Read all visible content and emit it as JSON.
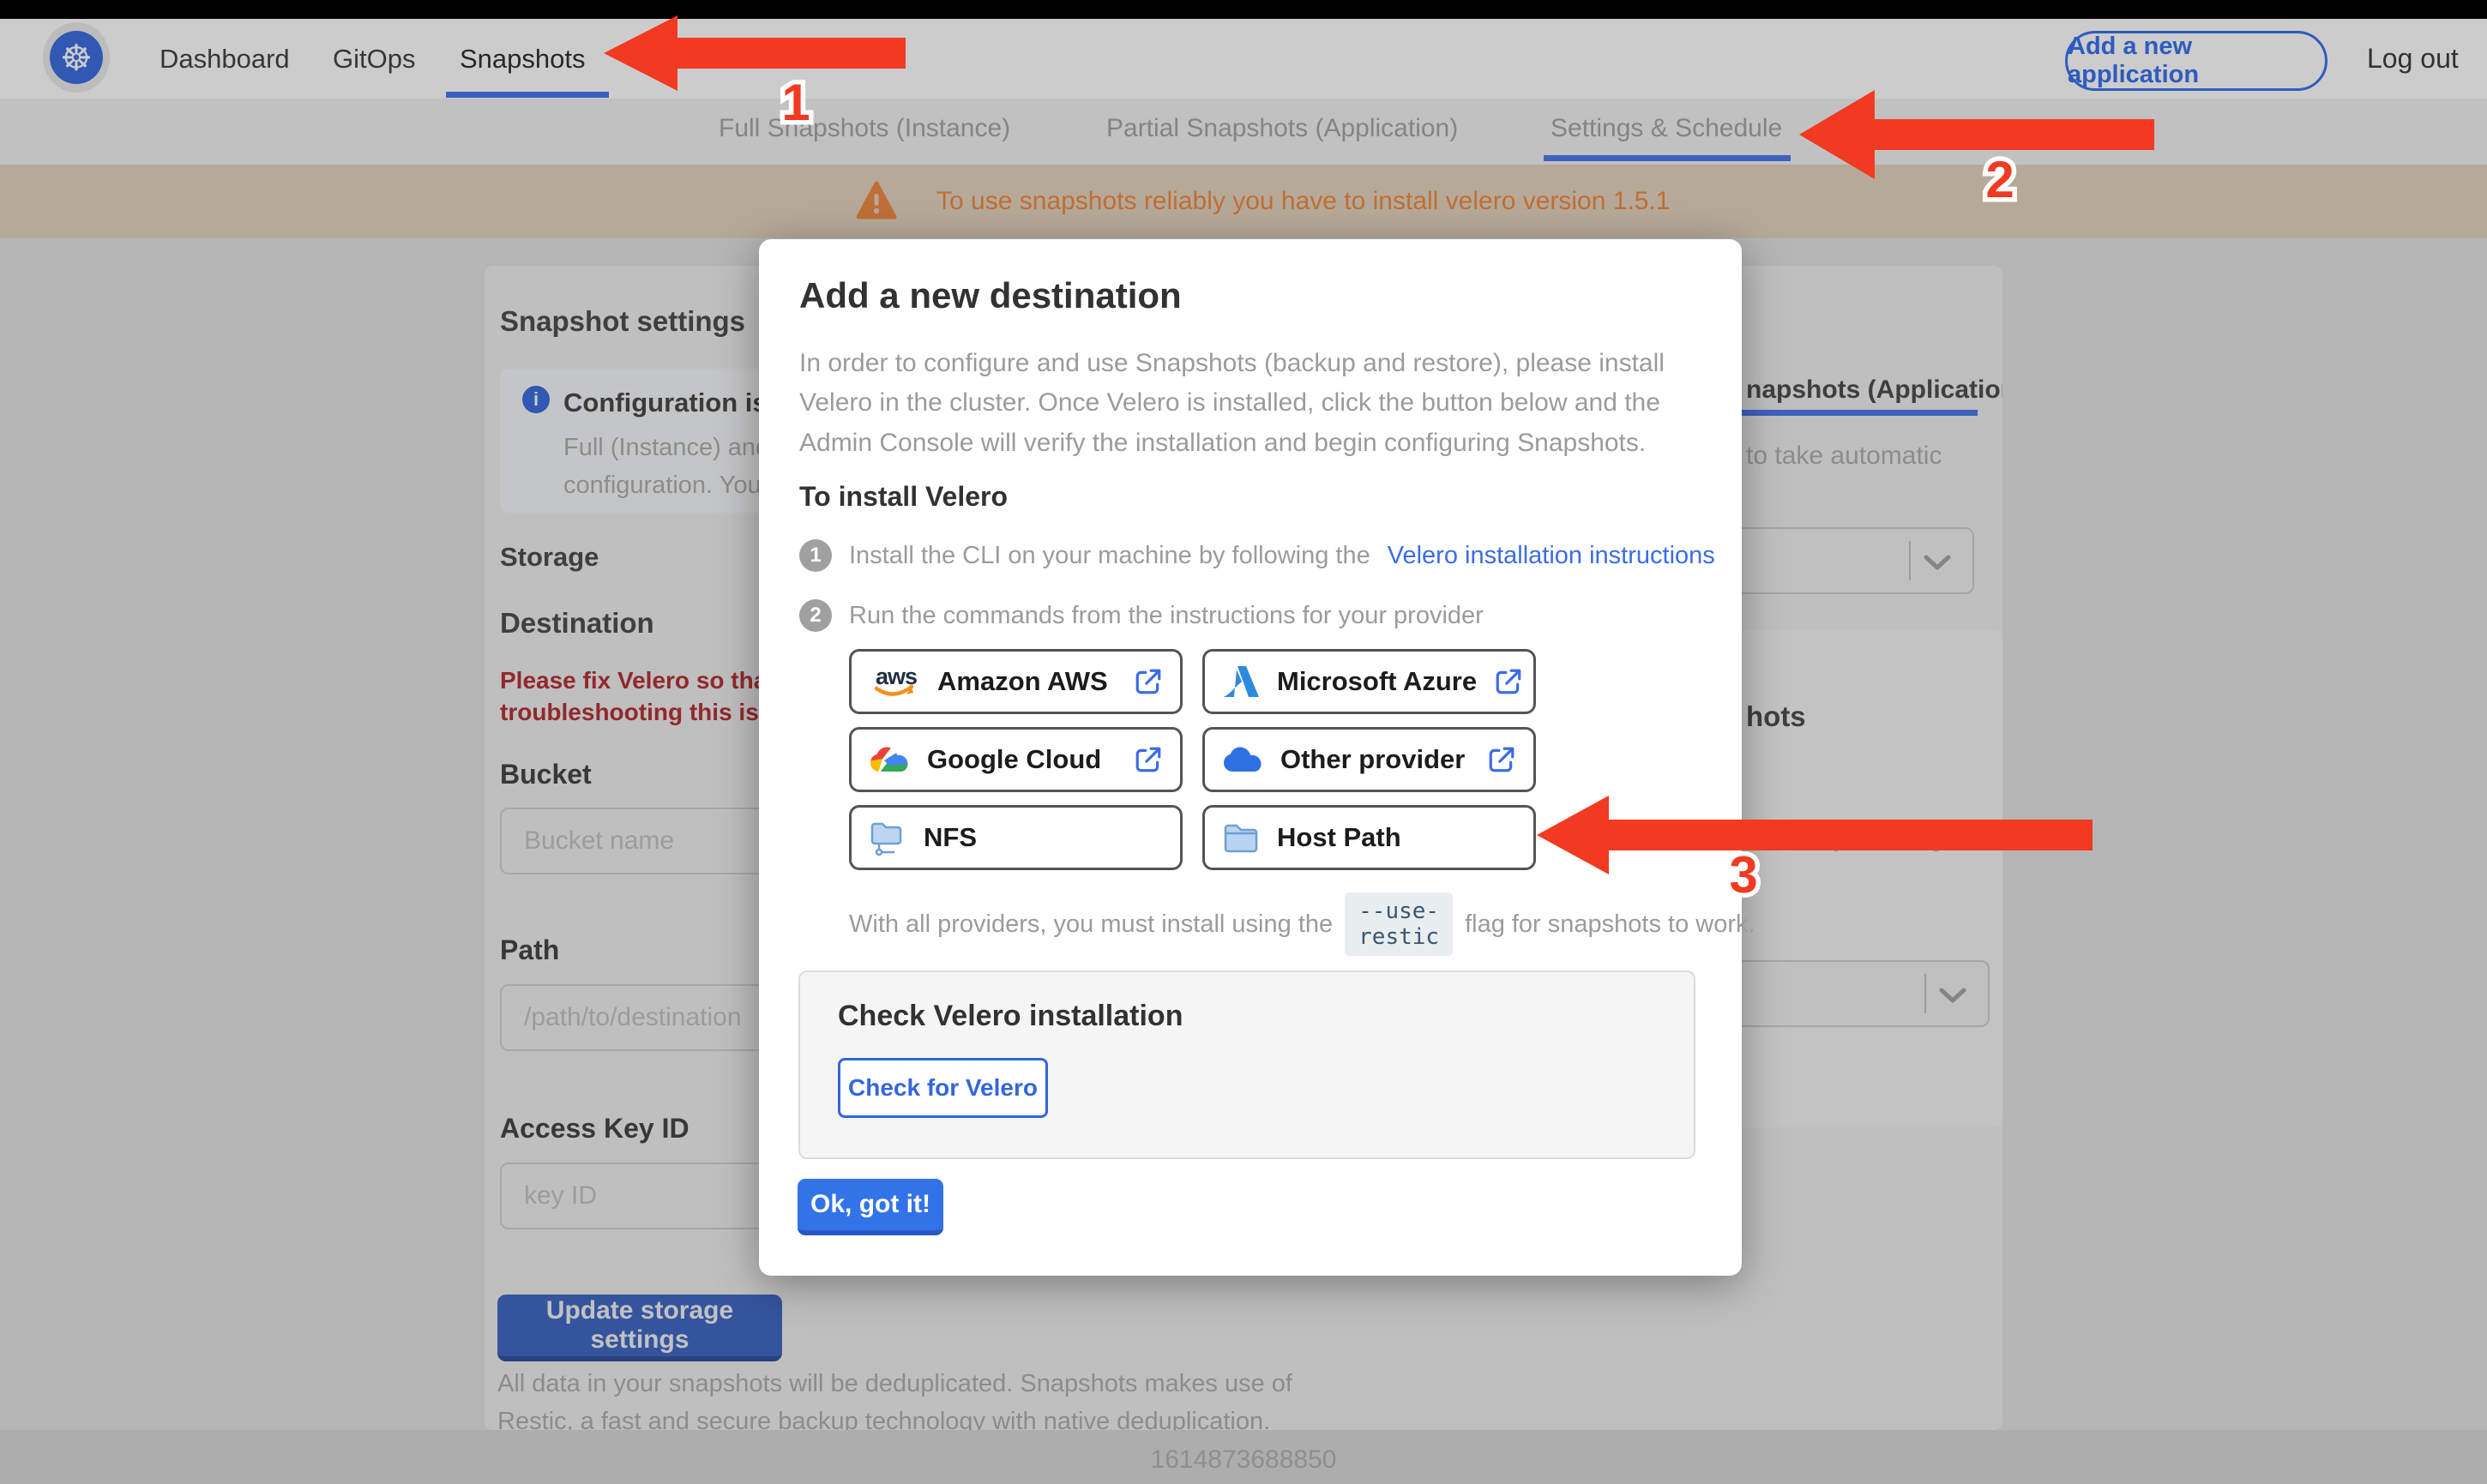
{
  "navbar": {
    "items": [
      "Dashboard",
      "GitOps",
      "Snapshots"
    ],
    "active_item": "Snapshots",
    "add_application_label": "Add a new application",
    "logout_label": "Log out"
  },
  "tabs": {
    "items": [
      "Full Snapshots (Instance)",
      "Partial Snapshots (Application)",
      "Settings & Schedule"
    ],
    "active": "Settings & Schedule"
  },
  "warning_banner": {
    "text": "To use snapshots reliably you have to install velero version 1.5.1"
  },
  "snapshot_settings": {
    "title": "Snapshot settings",
    "info_box": {
      "title_visible": "Configuration is sh",
      "line1_visible": "Full (Instance) and Parti",
      "line2_visible": "configuration. Your stor"
    },
    "storage_heading": "Storage",
    "destination_heading": "Destination",
    "error_line1": "Please fix Velero so that th",
    "error_line2": "troubleshooting this issue",
    "fields": [
      {
        "label": "Bucket",
        "placeholder": "Bucket name"
      },
      {
        "label": "Path",
        "placeholder": "/path/to/destination"
      },
      {
        "label": "Access Key ID",
        "placeholder": "key ID"
      }
    ],
    "update_button_label": "Update storage settings",
    "footnote_line1": "All data in your snapshots will be deduplicated. Snapshots makes use of",
    "footnote_line2": "Restic, a fast and secure backup technology with native deduplication."
  },
  "schedule_panel": {
    "subtab_visible": "napshots (Application)",
    "auto_text_visible": "to take automatic",
    "heading_visible": "hots",
    "retention_text_visible": "matically deleting older"
  },
  "footer": {
    "timestamp": "1614873688850"
  },
  "modal": {
    "title": "Add a new destination",
    "intro_line1": "In order to configure and use Snapshots (backup and restore), please install",
    "intro_line2": "Velero in the cluster. Once Velero is installed, click the button below and the",
    "intro_line3": "Admin Console will verify the installation and begin configuring Snapshots.",
    "install_heading": "To install Velero",
    "step1_num": "1",
    "step1_text": "Install the CLI on your machine by following the",
    "step1_link": "Velero installation instructions",
    "step2_num": "2",
    "step2_text": "Run the commands from the instructions for your provider",
    "providers": [
      {
        "label": "Amazon AWS"
      },
      {
        "label": "Microsoft Azure"
      },
      {
        "label": "Google Cloud"
      },
      {
        "label": "Other provider"
      },
      {
        "label": "NFS"
      },
      {
        "label": "Host Path"
      }
    ],
    "restic_before": "With all providers, you must install using the",
    "restic_code": "--use-restic",
    "restic_after": "flag for snapshots to work.",
    "check_heading": "Check Velero installation",
    "check_button_label": "Check for Velero",
    "ok_button_label": "Ok, got it!"
  },
  "annotations": {
    "labels": [
      "1",
      "2",
      "3"
    ]
  },
  "colors": {
    "accent_blue": "#3b6ce8",
    "arrow_red": "#f23a22",
    "warning_orange": "#ef8b45",
    "error_red": "#b83238",
    "kubernetes_blue": "#3e6fe0"
  }
}
